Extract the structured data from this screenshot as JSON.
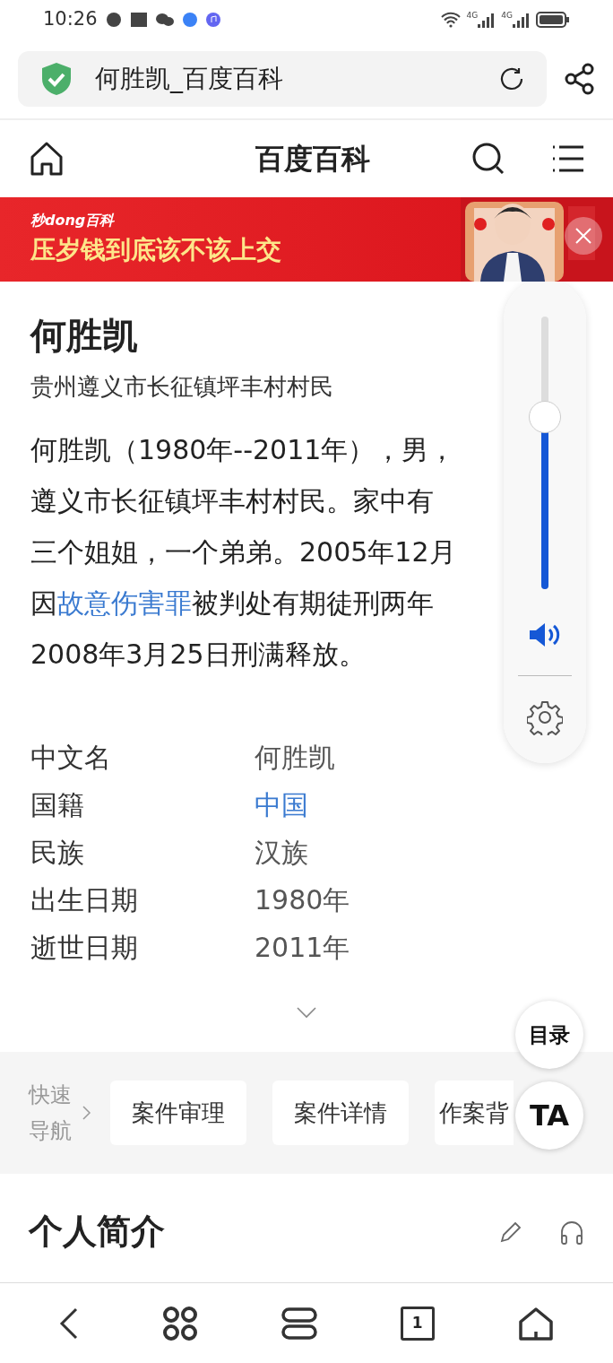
{
  "status_bar": {
    "time": "10:26",
    "network_1": "4G",
    "network_2": "4G"
  },
  "address_bar": {
    "title": "何胜凯_百度百科"
  },
  "header": {
    "title": "百度百科"
  },
  "banner": {
    "logo": "秒dong百科",
    "headline": "压岁钱到底该不该上交",
    "kind": "picture"
  },
  "article": {
    "title": "何胜凯",
    "subtitle": "贵州遵义市长征镇坪丰村村民",
    "paragraph_lines": [
      [
        {
          "text": "何胜凯（1980年--2011年），男，",
          "link": false
        }
      ],
      [
        {
          "text": "遵义市长征镇坪丰村村民。家中有",
          "link": false
        }
      ],
      [
        {
          "text": "三个姐姐，一个弟弟。2005年12月",
          "link": false
        }
      ],
      [
        {
          "text": "因",
          "link": false
        },
        {
          "text": "故意伤害罪",
          "link": true
        },
        {
          "text": "被判处有期徒刑两年",
          "link": false
        }
      ],
      [
        {
          "text": "2008年3月25日刑满释放。",
          "link": false
        }
      ]
    ],
    "info": [
      {
        "label": "中文名",
        "value": "何胜凯",
        "link": false
      },
      {
        "label": "国籍",
        "value": "中国",
        "link": true
      },
      {
        "label": "民族",
        "value": "汉族",
        "link": false
      },
      {
        "label": "出生日期",
        "value": "1980年",
        "link": false
      },
      {
        "label": "逝世日期",
        "value": "2011年",
        "link": false
      }
    ]
  },
  "quick_nav": {
    "label": "快速导航",
    "items": [
      {
        "label": "案件审理"
      },
      {
        "label": "案件详情"
      },
      {
        "label": "作案背"
      }
    ]
  },
  "section": {
    "title": "个人简介"
  },
  "volume": {
    "level": 0.63
  },
  "floating_buttons": [
    {
      "label": "目录"
    },
    {
      "label": "TA"
    }
  ],
  "bottom_nav": {
    "tab_count": "1"
  }
}
